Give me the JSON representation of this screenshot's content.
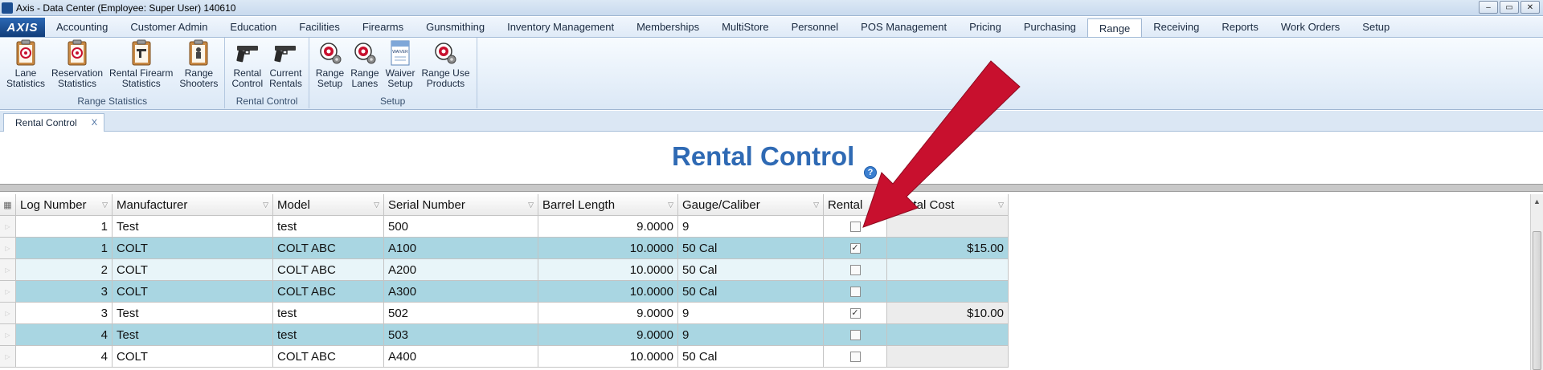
{
  "window": {
    "title": "Axis - Data Center  (Employee: Super User) 140610",
    "controls": [
      "–",
      "▭",
      "✕"
    ]
  },
  "menubar": {
    "logo": "AXIS",
    "items": [
      "Accounting",
      "Customer Admin",
      "Education",
      "Facilities",
      "Firearms",
      "Gunsmithing",
      "Inventory Management",
      "Memberships",
      "MultiStore",
      "Personnel",
      "POS Management",
      "Pricing",
      "Purchasing",
      "Range",
      "Receiving",
      "Reports",
      "Work Orders",
      "Setup"
    ],
    "active": "Range"
  },
  "ribbon": {
    "groups": [
      {
        "title": "Range Statistics",
        "buttons": [
          {
            "label": "Lane\nStatistics",
            "icon": "target-clipboard-icon"
          },
          {
            "label": "Reservation\nStatistics",
            "icon": "target-clipboard-icon"
          },
          {
            "label": "Rental Firearm\nStatistics",
            "icon": "rifle-clipboard-icon"
          },
          {
            "label": "Range\nShooters",
            "icon": "shooter-clipboard-icon"
          }
        ]
      },
      {
        "title": "Rental Control",
        "buttons": [
          {
            "label": "Rental\nControl",
            "icon": "pistol-icon"
          },
          {
            "label": "Current\nRentals",
            "icon": "pistol-icon"
          }
        ]
      },
      {
        "title": "Setup",
        "buttons": [
          {
            "label": "Range\nSetup",
            "icon": "target-gear-icon"
          },
          {
            "label": "Range\nLanes",
            "icon": "target-gear-icon"
          },
          {
            "label": "Waiver\nSetup",
            "icon": "waiver-document-icon",
            "badge": "WAIVER"
          },
          {
            "label": "Range Use\nProducts",
            "icon": "target-gear-icon"
          }
        ]
      }
    ]
  },
  "doc_tab": {
    "label": "Rental Control",
    "close": "X"
  },
  "page": {
    "title": "Rental Control",
    "help": "?"
  },
  "grid": {
    "columns": [
      "Log Number",
      "Manufacturer",
      "Model",
      "Serial Number",
      "Barrel Length",
      "Gauge/Caliber",
      "Rental",
      "Rental Cost"
    ],
    "rows": [
      {
        "log": "1",
        "manufacturer": "Test",
        "model": "test",
        "serial": "500",
        "barrel": "9.0000",
        "gauge": "9",
        "rental": false,
        "cost": ""
      },
      {
        "log": "1",
        "manufacturer": "COLT",
        "model": "COLT ABC",
        "serial": "A100",
        "barrel": "10.0000",
        "gauge": "50 Cal",
        "rental": true,
        "cost": "$15.00"
      },
      {
        "log": "2",
        "manufacturer": "COLT",
        "model": "COLT ABC",
        "serial": "A200",
        "barrel": "10.0000",
        "gauge": "50 Cal",
        "rental": false,
        "cost": ""
      },
      {
        "log": "3",
        "manufacturer": "COLT",
        "model": "COLT ABC",
        "serial": "A300",
        "barrel": "10.0000",
        "gauge": "50 Cal",
        "rental": false,
        "cost": ""
      },
      {
        "log": "3",
        "manufacturer": "Test",
        "model": "test",
        "serial": "502",
        "barrel": "9.0000",
        "gauge": "9",
        "rental": true,
        "cost": "$10.00"
      },
      {
        "log": "4",
        "manufacturer": "Test",
        "model": "test",
        "serial": "503",
        "barrel": "9.0000",
        "gauge": "9",
        "rental": false,
        "cost": ""
      },
      {
        "log": "4",
        "manufacturer": "COLT",
        "model": "COLT ABC",
        "serial": "A400",
        "barrel": "10.0000",
        "gauge": "50 Cal",
        "rental": false,
        "cost": ""
      }
    ]
  },
  "colors": {
    "title_blue": "#2f6ab4",
    "row_highlight": "#a9d6e2",
    "row_light": "#e8f5f9",
    "annotation_arrow": "#c8102e"
  }
}
